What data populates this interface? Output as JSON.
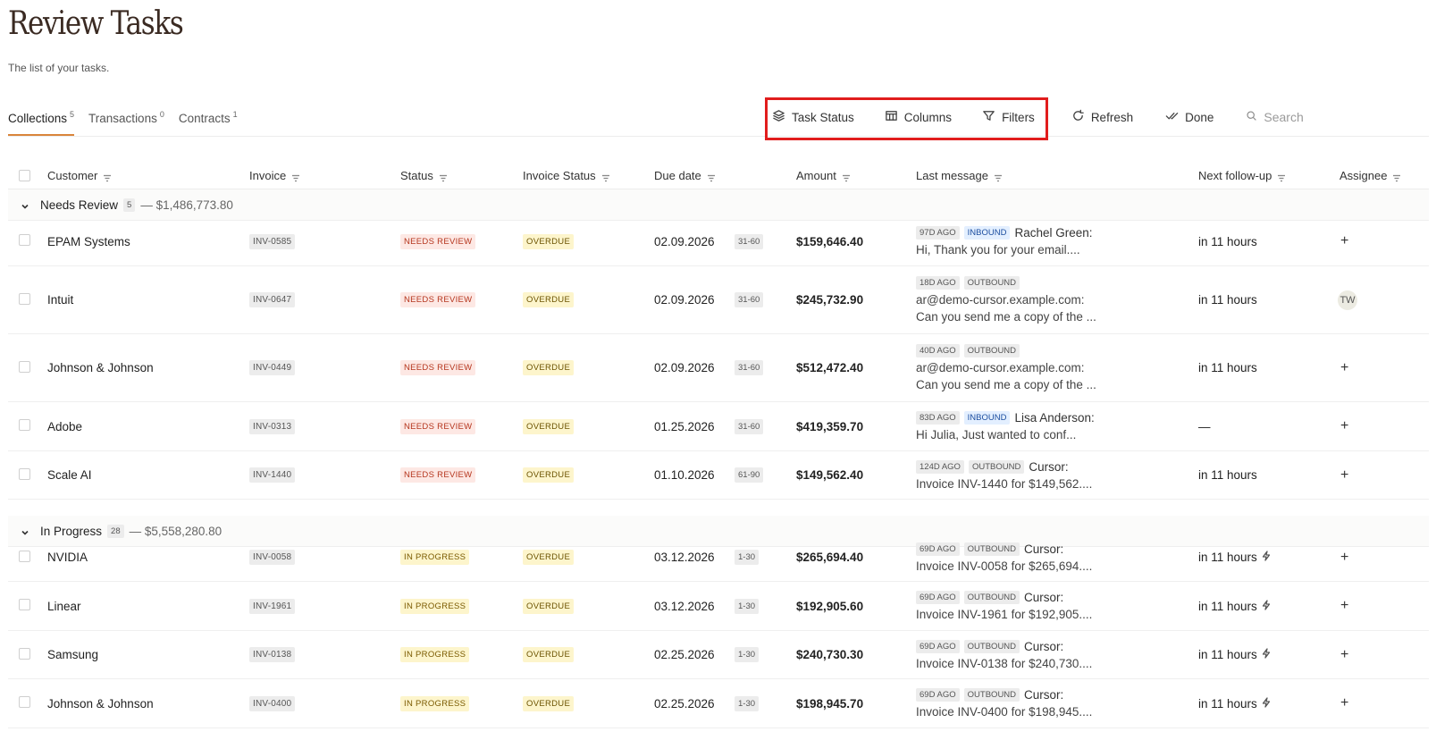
{
  "page": {
    "title": "Review Tasks",
    "subtitle": "The list of your tasks."
  },
  "tabs": [
    {
      "label": "Collections",
      "count": "5"
    },
    {
      "label": "Transactions",
      "count": "0"
    },
    {
      "label": "Contracts",
      "count": "1"
    }
  ],
  "toolbar": {
    "task_status": "Task Status",
    "columns": "Columns",
    "filters": "Filters",
    "refresh": "Refresh",
    "done": "Done",
    "search_placeholder": "Search"
  },
  "headers": {
    "customer": "Customer",
    "invoice": "Invoice",
    "status": "Status",
    "invoice_status": "Invoice Status",
    "due_date": "Due date",
    "amount": "Amount",
    "last_message": "Last message",
    "next_followup": "Next follow-up",
    "assignee": "Assignee"
  },
  "groups": [
    {
      "name": "Needs Review",
      "count": "5",
      "total": "— $1,486,773.80",
      "rows": [
        {
          "customer": "EPAM Systems",
          "invoice": "INV-0585",
          "status": "NEEDS REVIEW",
          "invoice_status": "OVERDUE",
          "due": "02.09.2026",
          "aging": "31-60",
          "amount": "$159,646.40",
          "msg_ago": "97D AGO",
          "msg_dir": "INBOUND",
          "msg_from": "Rachel Green:",
          "msg_lines": [
            "Hi, Thank you for your email...."
          ],
          "followup": "in 11 hours",
          "bolt": false,
          "assignee": "+"
        },
        {
          "customer": "Intuit",
          "invoice": "INV-0647",
          "status": "NEEDS REVIEW",
          "invoice_status": "OVERDUE",
          "due": "02.09.2026",
          "aging": "31-60",
          "amount": "$245,732.90",
          "msg_ago": "18D AGO",
          "msg_dir": "OUTBOUND",
          "msg_from": "",
          "msg_lines": [
            "ar@demo-cursor.example.com:",
            "Can you send me a copy of the ..."
          ],
          "followup": "in 11 hours",
          "bolt": false,
          "assignee": "TW"
        },
        {
          "customer": "Johnson & Johnson",
          "invoice": "INV-0449",
          "status": "NEEDS REVIEW",
          "invoice_status": "OVERDUE",
          "due": "02.09.2026",
          "aging": "31-60",
          "amount": "$512,472.40",
          "msg_ago": "40D AGO",
          "msg_dir": "OUTBOUND",
          "msg_from": "",
          "msg_lines": [
            "ar@demo-cursor.example.com:",
            "Can you send me a copy of the ..."
          ],
          "followup": "in 11 hours",
          "bolt": false,
          "assignee": "+"
        },
        {
          "customer": "Adobe",
          "invoice": "INV-0313",
          "status": "NEEDS REVIEW",
          "invoice_status": "OVERDUE",
          "due": "01.25.2026",
          "aging": "31-60",
          "amount": "$419,359.70",
          "msg_ago": "83D AGO",
          "msg_dir": "INBOUND",
          "msg_from": "Lisa Anderson:",
          "msg_lines": [
            "Hi Julia, Just wanted to conf..."
          ],
          "followup": "—",
          "bolt": false,
          "assignee": "+"
        },
        {
          "customer": "Scale AI",
          "invoice": "INV-1440",
          "status": "NEEDS REVIEW",
          "invoice_status": "OVERDUE",
          "due": "01.10.2026",
          "aging": "61-90",
          "amount": "$149,562.40",
          "msg_ago": "124D AGO",
          "msg_dir": "OUTBOUND",
          "msg_from": "Cursor:",
          "msg_lines": [
            "Invoice INV-1440 for $149,562...."
          ],
          "followup": "in 11 hours",
          "bolt": false,
          "assignee": "+"
        }
      ]
    },
    {
      "name": "In Progress",
      "count": "28",
      "total": "— $5,558,280.80",
      "rows": [
        {
          "customer": "NVIDIA",
          "invoice": "INV-0058",
          "status": "IN PROGRESS",
          "invoice_status": "OVERDUE",
          "due": "03.12.2026",
          "aging": "1-30",
          "amount": "$265,694.40",
          "msg_ago": "69D AGO",
          "msg_dir": "OUTBOUND",
          "msg_from": "Cursor:",
          "msg_lines": [
            "Invoice INV-0058 for $265,694...."
          ],
          "followup": "in 11 hours",
          "bolt": true,
          "assignee": "+"
        },
        {
          "customer": "Linear",
          "invoice": "INV-1961",
          "status": "IN PROGRESS",
          "invoice_status": "OVERDUE",
          "due": "03.12.2026",
          "aging": "1-30",
          "amount": "$192,905.60",
          "msg_ago": "69D AGO",
          "msg_dir": "OUTBOUND",
          "msg_from": "Cursor:",
          "msg_lines": [
            "Invoice INV-1961 for $192,905...."
          ],
          "followup": "in 11 hours",
          "bolt": true,
          "assignee": "+"
        },
        {
          "customer": "Samsung",
          "invoice": "INV-0138",
          "status": "IN PROGRESS",
          "invoice_status": "OVERDUE",
          "due": "02.25.2026",
          "aging": "1-30",
          "amount": "$240,730.30",
          "msg_ago": "69D AGO",
          "msg_dir": "OUTBOUND",
          "msg_from": "Cursor:",
          "msg_lines": [
            "Invoice INV-0138 for $240,730...."
          ],
          "followup": "in 11 hours",
          "bolt": true,
          "assignee": "+"
        },
        {
          "customer": "Johnson & Johnson",
          "invoice": "INV-0400",
          "status": "IN PROGRESS",
          "invoice_status": "OVERDUE",
          "due": "02.25.2026",
          "aging": "1-30",
          "amount": "$198,945.70",
          "msg_ago": "69D AGO",
          "msg_dir": "OUTBOUND",
          "msg_from": "Cursor:",
          "msg_lines": [
            "Invoice INV-0400 for $198,945...."
          ],
          "followup": "in 11 hours",
          "bolt": true,
          "assignee": "+"
        }
      ]
    }
  ]
}
